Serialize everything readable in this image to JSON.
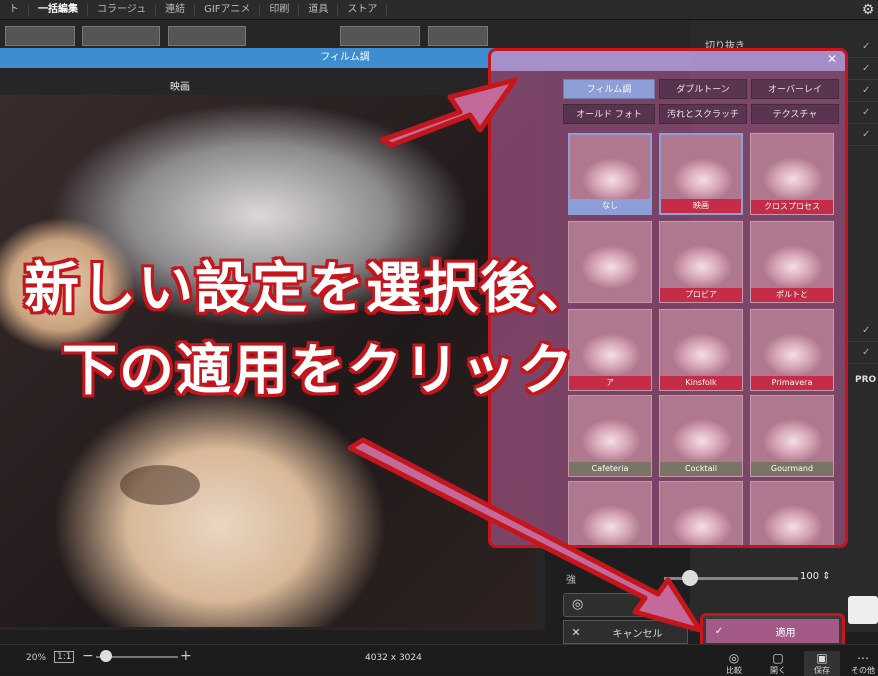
{
  "topbar": {
    "tabs": [
      "ト",
      "一括編集",
      "コラージュ",
      "連結",
      "GIFアニメ",
      "印刷",
      "道具",
      "ストア"
    ],
    "active_index": 1
  },
  "dialog": {
    "title": "フィルム調",
    "preview_label": "映画"
  },
  "sidebar": {
    "top_label": "切り抜き",
    "pro_label": "PRO"
  },
  "film_panel": {
    "categories": [
      [
        "フィルム調",
        "ダブルトーン",
        "オーバーレイ"
      ],
      [
        "オールド フォト",
        "汚れとスクラッチ",
        "テクスチャ"
      ]
    ],
    "active_category": "フィルム調",
    "presets": [
      [
        "なし",
        "映画",
        "クロスプロセス"
      ],
      [
        "",
        "プロビア",
        "ポルトと"
      ],
      [
        "ア",
        "Kinsfolk",
        "Primavera"
      ],
      [
        "Cafeteria",
        "Cocktail",
        "Gourmand"
      ]
    ],
    "selected_preset": "映画"
  },
  "annotation": {
    "line1": "新しい設定を選択後、",
    "line2": "下の適用をクリック"
  },
  "controls": {
    "strength_label": "強",
    "strength_value": "100 ⇕",
    "strength_fraction": 1.0,
    "cancel_label": "キャンセル",
    "apply_label": "適用"
  },
  "bottombar": {
    "zoom": "20%",
    "fit": "1:1",
    "dimensions": "4032 x 3024",
    "buttons": [
      "比較",
      "開く",
      "保存",
      "その他"
    ]
  },
  "colors": {
    "accent_red": "#c4161c",
    "title_blue": "#3d8ed1",
    "panel_overlay": "#944e7a",
    "active_tab": "#8e9ed6"
  }
}
